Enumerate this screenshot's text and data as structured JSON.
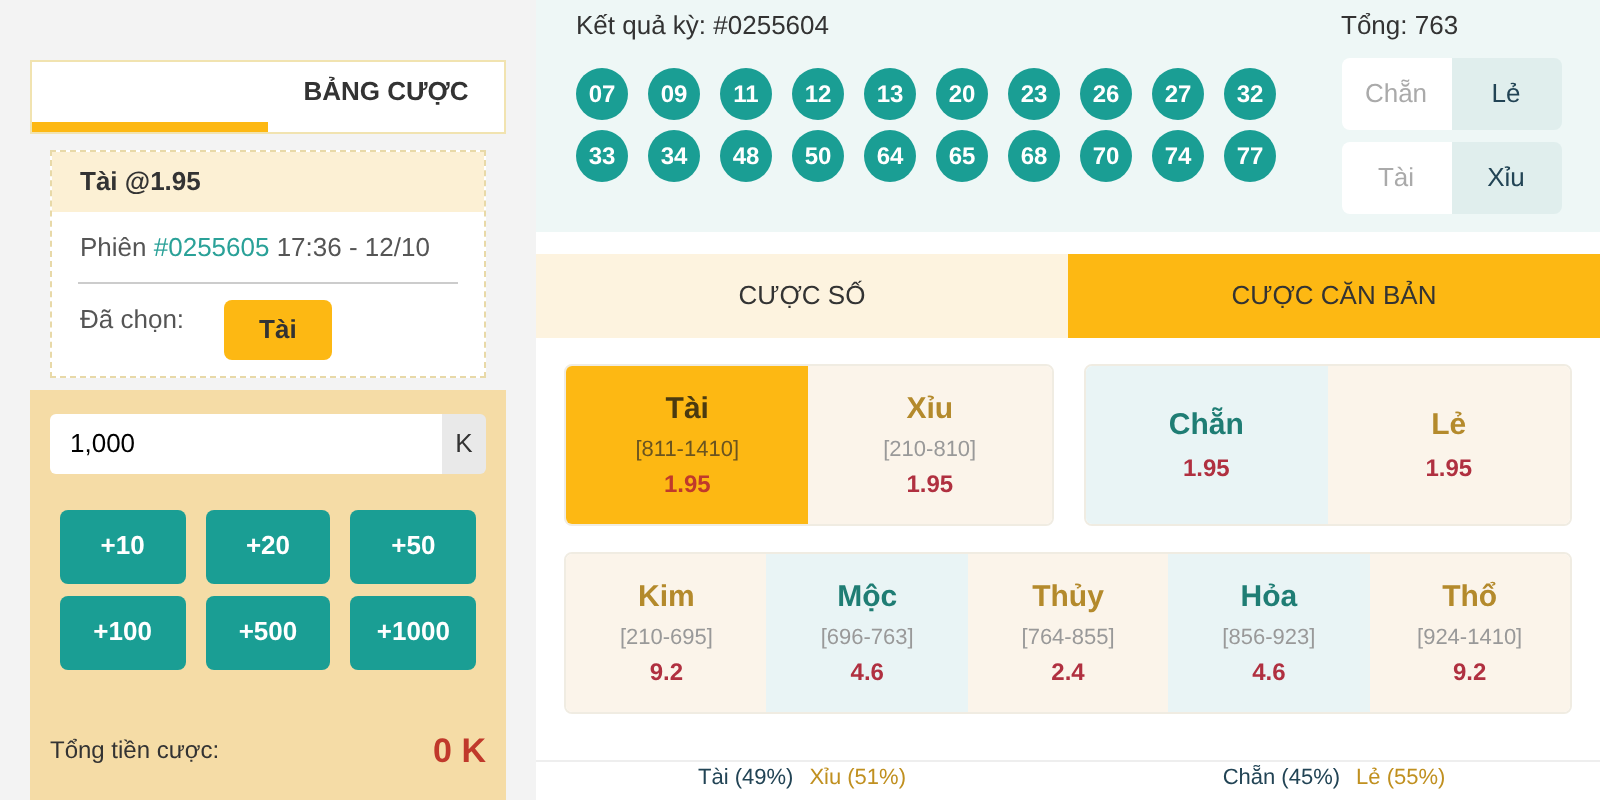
{
  "bet_slip": {
    "tabs": [
      {
        "selected": true
      },
      {
        "label": "BẢNG CƯỢC",
        "selected": false
      }
    ],
    "ticket": {
      "title": "Tài @1.95",
      "session_label": "Phiên",
      "session_id": "#0255605",
      "session_time": "17:36 - 12/10",
      "chosen_label": "Đã chọn:",
      "chosen": "Tài"
    },
    "amount": {
      "value": "1,000",
      "unit": "K"
    },
    "quick_buttons": [
      "+10",
      "+20",
      "+50",
      "+100",
      "+500",
      "+1000"
    ],
    "total_label": "Tổng tiền cược:",
    "total": "0 K"
  },
  "result": {
    "title": "Kết quả kỳ: #0255604",
    "sum": "Tổng: 763",
    "balls": [
      "07",
      "09",
      "11",
      "12",
      "13",
      "20",
      "23",
      "26",
      "27",
      "32",
      "33",
      "34",
      "48",
      "50",
      "64",
      "65",
      "68",
      "70",
      "74",
      "77"
    ],
    "toggles": [
      [
        {
          "label": "Chẵn",
          "selected": false
        },
        {
          "label": "Lẻ",
          "selected": true
        }
      ],
      [
        {
          "label": "Tài",
          "selected": false
        },
        {
          "label": "Xỉu",
          "selected": true
        }
      ]
    ]
  },
  "bet_tabs": [
    {
      "label": "CƯỢC SỐ",
      "selected": false
    },
    {
      "label": "CƯỢC CĂN BẢN",
      "selected": true
    }
  ],
  "bet_groups": [
    [
      {
        "name": "Tài",
        "range": "[811-1410]",
        "odds": "1.95",
        "kind": "warm",
        "selected": true
      },
      {
        "name": "Xỉu",
        "range": "[210-810]",
        "odds": "1.95",
        "kind": "warm",
        "selected": false
      }
    ],
    [
      {
        "name": "Chẵn",
        "odds": "1.95",
        "kind": "cool",
        "selected": false
      },
      {
        "name": "Lẻ",
        "odds": "1.95",
        "kind": "warm",
        "selected": false
      }
    ],
    [
      {
        "name": "Kim",
        "range": "[210-695]",
        "odds": "9.2",
        "kind": "warm",
        "selected": false
      },
      {
        "name": "Mộc",
        "range": "[696-763]",
        "odds": "4.6",
        "kind": "cool",
        "selected": false
      },
      {
        "name": "Thủy",
        "range": "[764-855]",
        "odds": "2.4",
        "kind": "warm",
        "selected": false
      },
      {
        "name": "Hỏa",
        "range": "[856-923]",
        "odds": "4.6",
        "kind": "cool",
        "selected": false
      },
      {
        "name": "Thổ",
        "range": "[924-1410]",
        "odds": "9.2",
        "kind": "warm",
        "selected": false
      }
    ]
  ],
  "stats": [
    [
      {
        "text": "Tài (49%)",
        "kind": "cool"
      },
      {
        "text": "Xỉu (51%)",
        "kind": "warm"
      }
    ],
    [
      {
        "text": "Chẵn (45%)",
        "kind": "cool"
      },
      {
        "text": "Lẻ (55%)",
        "kind": "warm"
      }
    ]
  ]
}
